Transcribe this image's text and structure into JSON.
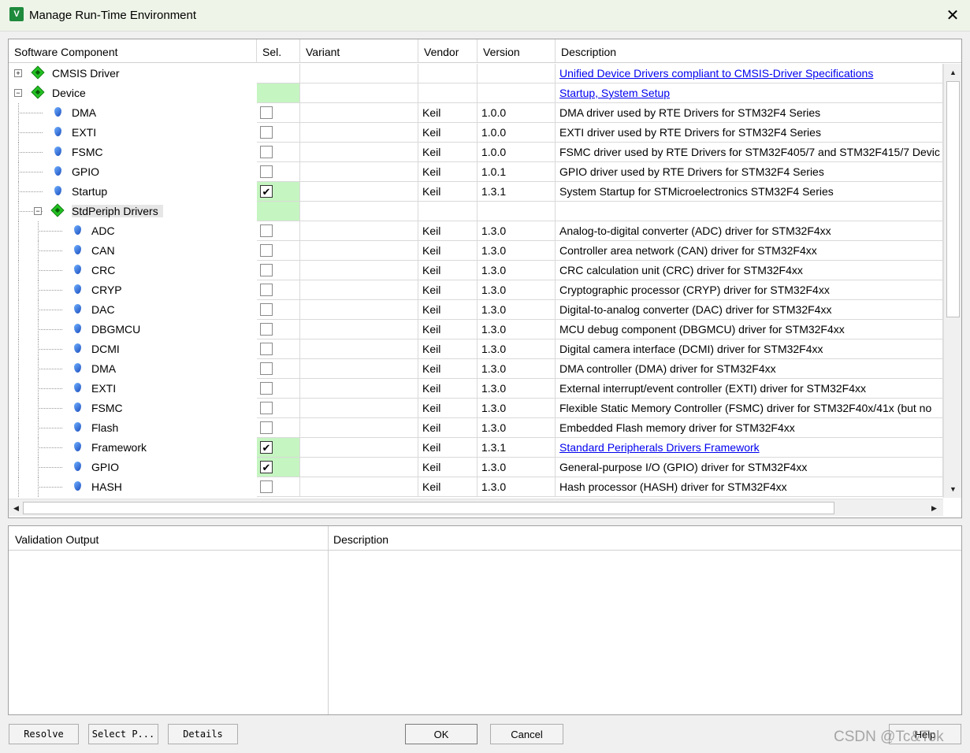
{
  "window": {
    "title": "Manage Run-Time Environment",
    "icon_text": "V"
  },
  "columns": [
    "Software Component",
    "Sel.",
    "Variant",
    "Vendor",
    "Version",
    "Description"
  ],
  "rows": [
    {
      "name": "CMSIS Driver",
      "level": 0,
      "kind": "group",
      "expander": "+",
      "sel": "none",
      "vendor": "",
      "version": "",
      "desc": "Unified Device Drivers compliant to CMSIS-Driver Specifications",
      "link": true
    },
    {
      "name": "Device",
      "level": 0,
      "kind": "group",
      "expander": "-",
      "sel": "green",
      "vendor": "",
      "version": "",
      "desc": "Startup, System Setup",
      "link": true
    },
    {
      "name": "DMA",
      "level": 1,
      "kind": "leaf",
      "sel": "unchecked",
      "vendor": "Keil",
      "version": "1.0.0",
      "desc": "DMA driver used by RTE Drivers for STM32F4 Series",
      "link": false
    },
    {
      "name": "EXTI",
      "level": 1,
      "kind": "leaf",
      "sel": "unchecked",
      "vendor": "Keil",
      "version": "1.0.0",
      "desc": "EXTI driver used by RTE Drivers for STM32F4 Series",
      "link": false
    },
    {
      "name": "FSMC",
      "level": 1,
      "kind": "leaf",
      "sel": "unchecked",
      "vendor": "Keil",
      "version": "1.0.0",
      "desc": "FSMC driver used by RTE Drivers for STM32F405/7 and STM32F415/7 Devic",
      "link": false
    },
    {
      "name": "GPIO",
      "level": 1,
      "kind": "leaf",
      "sel": "unchecked",
      "vendor": "Keil",
      "version": "1.0.1",
      "desc": "GPIO driver used by RTE Drivers for STM32F4 Series",
      "link": false
    },
    {
      "name": "Startup",
      "level": 1,
      "kind": "leaf",
      "sel": "checked",
      "vendor": "Keil",
      "version": "1.3.1",
      "desc": "System Startup for STMicroelectronics STM32F4 Series",
      "link": false
    },
    {
      "name": "StdPeriph Drivers",
      "level": 1,
      "kind": "group",
      "expander": "-",
      "sel": "green",
      "vendor": "",
      "version": "",
      "desc": "",
      "link": false,
      "highlight": true
    },
    {
      "name": "ADC",
      "level": 2,
      "kind": "leaf",
      "sel": "unchecked",
      "vendor": "Keil",
      "version": "1.3.0",
      "desc": "Analog-to-digital converter (ADC) driver for STM32F4xx",
      "link": false
    },
    {
      "name": "CAN",
      "level": 2,
      "kind": "leaf",
      "sel": "unchecked",
      "vendor": "Keil",
      "version": "1.3.0",
      "desc": "Controller area network (CAN) driver for STM32F4xx",
      "link": false
    },
    {
      "name": "CRC",
      "level": 2,
      "kind": "leaf",
      "sel": "unchecked",
      "vendor": "Keil",
      "version": "1.3.0",
      "desc": "CRC calculation unit (CRC) driver for STM32F4xx",
      "link": false
    },
    {
      "name": "CRYP",
      "level": 2,
      "kind": "leaf",
      "sel": "unchecked",
      "vendor": "Keil",
      "version": "1.3.0",
      "desc": "Cryptographic processor (CRYP) driver for STM32F4xx",
      "link": false
    },
    {
      "name": "DAC",
      "level": 2,
      "kind": "leaf",
      "sel": "unchecked",
      "vendor": "Keil",
      "version": "1.3.0",
      "desc": "Digital-to-analog converter (DAC) driver for STM32F4xx",
      "link": false
    },
    {
      "name": "DBGMCU",
      "level": 2,
      "kind": "leaf",
      "sel": "unchecked",
      "vendor": "Keil",
      "version": "1.3.0",
      "desc": "MCU debug component (DBGMCU) driver for STM32F4xx",
      "link": false
    },
    {
      "name": "DCMI",
      "level": 2,
      "kind": "leaf",
      "sel": "unchecked",
      "vendor": "Keil",
      "version": "1.3.0",
      "desc": "Digital camera interface (DCMI) driver for STM32F4xx",
      "link": false
    },
    {
      "name": "DMA",
      "level": 2,
      "kind": "leaf",
      "sel": "unchecked",
      "vendor": "Keil",
      "version": "1.3.0",
      "desc": "DMA controller (DMA) driver for STM32F4xx",
      "link": false
    },
    {
      "name": "EXTI",
      "level": 2,
      "kind": "leaf",
      "sel": "unchecked",
      "vendor": "Keil",
      "version": "1.3.0",
      "desc": "External interrupt/event controller (EXTI) driver for STM32F4xx",
      "link": false
    },
    {
      "name": "FSMC",
      "level": 2,
      "kind": "leaf",
      "sel": "unchecked",
      "vendor": "Keil",
      "version": "1.3.0",
      "desc": "Flexible Static Memory Controller (FSMC) driver for STM32F40x/41x (but no",
      "link": false
    },
    {
      "name": "Flash",
      "level": 2,
      "kind": "leaf",
      "sel": "unchecked",
      "vendor": "Keil",
      "version": "1.3.0",
      "desc": "Embedded Flash memory driver for STM32F4xx",
      "link": false
    },
    {
      "name": "Framework",
      "level": 2,
      "kind": "leaf",
      "sel": "checked",
      "vendor": "Keil",
      "version": "1.3.1",
      "desc": "Standard Peripherals Drivers Framework",
      "link": true
    },
    {
      "name": "GPIO",
      "level": 2,
      "kind": "leaf",
      "sel": "checked",
      "vendor": "Keil",
      "version": "1.3.0",
      "desc": "General-purpose I/O (GPIO) driver for STM32F4xx",
      "link": false
    },
    {
      "name": "HASH",
      "level": 2,
      "kind": "leaf",
      "sel": "unchecked",
      "vendor": "Keil",
      "version": "1.3.0",
      "desc": "Hash processor (HASH) driver for STM32F4xx",
      "link": false
    }
  ],
  "validation": {
    "col1": "Validation Output",
    "col2": "Description"
  },
  "buttons": {
    "resolve": "Resolve",
    "select_packs": "Select P...",
    "details": "Details",
    "ok": "OK",
    "cancel": "Cancel",
    "help": "Help"
  },
  "watermark": "CSDN @Tc&Tok",
  "colors": {
    "selection_green": "#c5f5c0",
    "link_blue": "#0000ee",
    "title_bg": "#eef4e8"
  }
}
